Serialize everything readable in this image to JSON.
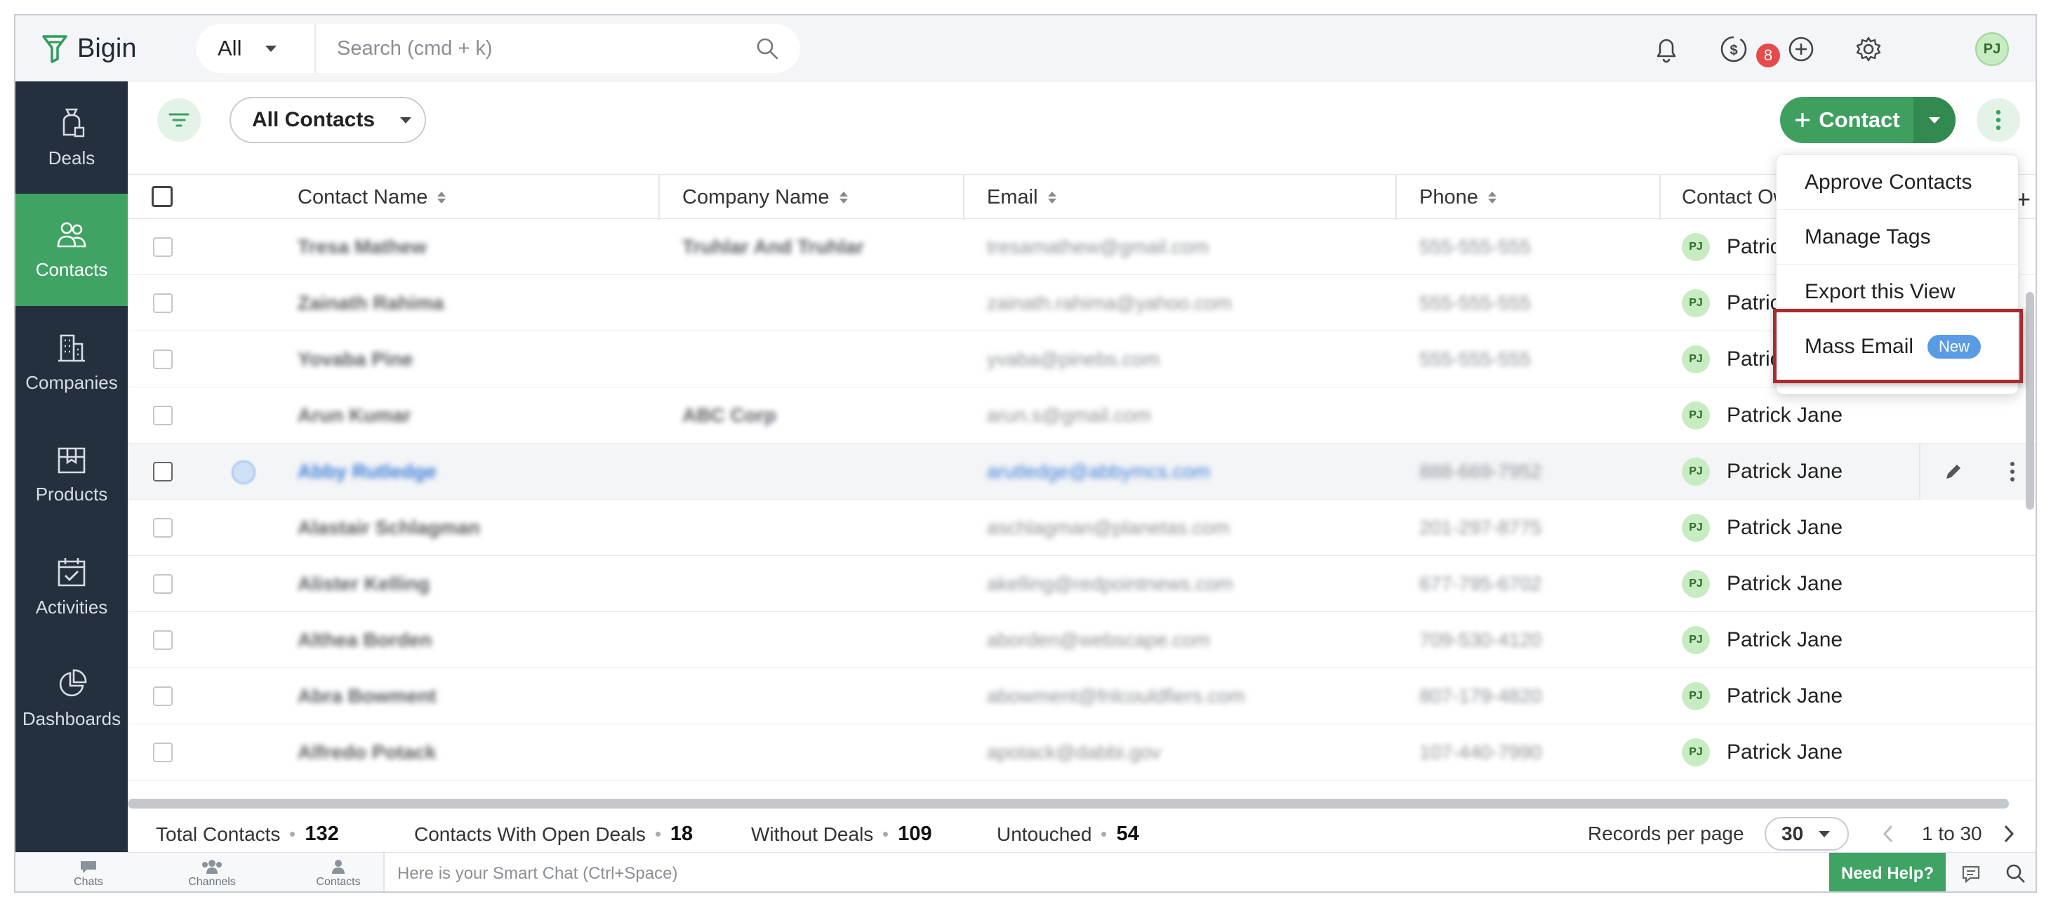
{
  "app": {
    "name": "Bigin"
  },
  "search": {
    "scope": "All",
    "placeholder": "Search (cmd + k)"
  },
  "topbar": {
    "notification_badge": "8",
    "avatar_initials": "PJ"
  },
  "sidebar": {
    "items": [
      {
        "label": "Deals",
        "icon": "bag-icon",
        "active": false
      },
      {
        "label": "Contacts",
        "icon": "people-icon",
        "active": true
      },
      {
        "label": "Companies",
        "icon": "building-icon",
        "active": false
      },
      {
        "label": "Products",
        "icon": "box-icon",
        "active": false
      },
      {
        "label": "Activities",
        "icon": "calendar-check-icon",
        "active": false
      },
      {
        "label": "Dashboards",
        "icon": "pie-chart-icon",
        "active": false
      }
    ]
  },
  "toolbar": {
    "view": "All Contacts",
    "add_label": "Contact"
  },
  "table": {
    "columns": [
      "Contact Name",
      "Company Name",
      "Email",
      "Phone",
      "Contact Ow"
    ],
    "rows": [
      {
        "name": "Tresa Mathew",
        "company": "Truhlar And Truhlar",
        "email": "tresamathew@gmail.com",
        "phone": "555-555-555",
        "owner": "Patrick",
        "owner_initials": "PJ"
      },
      {
        "name": "Zainath Rahima",
        "company": "",
        "email": "zainath.rahima@yahoo.com",
        "phone": "555-555-555",
        "owner": "Patrick",
        "owner_initials": "PJ"
      },
      {
        "name": "Yovaba Pine",
        "company": "",
        "email": "yvaba@pinebs.com",
        "phone": "555-555-555",
        "owner": "Patrick",
        "owner_initials": "PJ"
      },
      {
        "name": "Arun Kumar",
        "company": "ABC Corp",
        "email": "arun.s@gmail.com",
        "phone": "",
        "owner": "Patrick Jane",
        "owner_initials": "PJ"
      },
      {
        "name": "Abby Rutledge",
        "company": "",
        "email": "arutledge@abbymcs.com",
        "phone": "888-669-7952",
        "owner": "Patrick Jane",
        "owner_initials": "PJ"
      },
      {
        "name": "Alastair Schlagman",
        "company": "",
        "email": "aschlagman@planetas.com",
        "phone": "201-297-8775",
        "owner": "Patrick Jane",
        "owner_initials": "PJ"
      },
      {
        "name": "Alister Kelling",
        "company": "",
        "email": "akelling@redpointnews.com",
        "phone": "677-795-6702",
        "owner": "Patrick Jane",
        "owner_initials": "PJ"
      },
      {
        "name": "Althea Borden",
        "company": "",
        "email": "aborden@webscape.com",
        "phone": "709-530-4120",
        "owner": "Patrick Jane",
        "owner_initials": "PJ"
      },
      {
        "name": "Abra Bowment",
        "company": "",
        "email": "abowment@fnlcouldfiers.com",
        "phone": "807-179-4820",
        "owner": "Patrick Jane",
        "owner_initials": "PJ"
      },
      {
        "name": "Alfredo Potack",
        "company": "",
        "email": "apotack@dabbi.gov",
        "phone": "107-440-7990",
        "owner": "Patrick Jane",
        "owner_initials": "PJ"
      }
    ]
  },
  "menu": {
    "items": [
      "Approve Contacts",
      "Manage Tags",
      "Export this View",
      "Mass Email"
    ],
    "new_badge": "New"
  },
  "summary": {
    "total_label": "Total Contacts",
    "total": "132",
    "open_deals_label": "Contacts With Open Deals",
    "open_deals": "18",
    "without_label": "Without Deals",
    "without": "109",
    "untouched_label": "Untouched",
    "untouched": "54",
    "records_label": "Records per page",
    "records": "30",
    "range": "1 to 30"
  },
  "chatbar": {
    "chats": "Chats",
    "channels": "Channels",
    "contacts": "Contacts",
    "placeholder": "Here is your Smart Chat (Ctrl+Space)",
    "help": "Need Help?"
  },
  "colors": {
    "accent": "#3fa363",
    "sidebar": "#24303e",
    "highlight": "#a82b2e",
    "badge": "#e54b4b"
  }
}
